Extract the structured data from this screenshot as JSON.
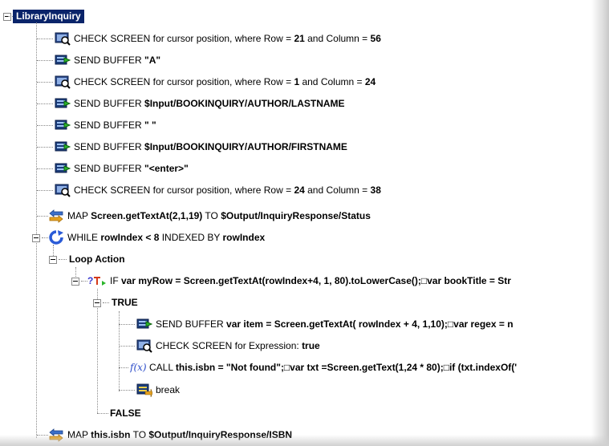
{
  "root": {
    "label": "LibraryInquiry"
  },
  "rows": [
    {
      "id": "r1",
      "icon": "screen-check-icon",
      "parts": [
        [
          "CHECK SCREEN for cursor position, where Row = ",
          false
        ],
        [
          "21",
          true
        ],
        [
          " and Column = ",
          false
        ],
        [
          "56",
          true
        ]
      ]
    },
    {
      "id": "r2",
      "icon": "send-buffer-icon",
      "parts": [
        [
          "SEND BUFFER ",
          false
        ],
        [
          "\"A\"",
          true
        ]
      ]
    },
    {
      "id": "r3",
      "icon": "screen-check-icon",
      "parts": [
        [
          "CHECK SCREEN for cursor position, where Row = ",
          false
        ],
        [
          "1",
          true
        ],
        [
          " and Column = ",
          false
        ],
        [
          "24",
          true
        ]
      ]
    },
    {
      "id": "r4",
      "icon": "send-buffer-icon",
      "parts": [
        [
          "SEND BUFFER ",
          false
        ],
        [
          "$Input/BOOKINQUIRY/AUTHOR/LASTNAME",
          true
        ]
      ]
    },
    {
      "id": "r5",
      "icon": "send-buffer-icon",
      "parts": [
        [
          "SEND BUFFER ",
          false
        ],
        [
          "\" \"",
          true
        ]
      ]
    },
    {
      "id": "r6",
      "icon": "send-buffer-icon",
      "parts": [
        [
          "SEND BUFFER ",
          false
        ],
        [
          "$Input/BOOKINQUIRY/AUTHOR/FIRSTNAME",
          true
        ]
      ]
    },
    {
      "id": "r7",
      "icon": "send-buffer-icon",
      "parts": [
        [
          "SEND BUFFER ",
          false
        ],
        [
          "\"<enter>\"",
          true
        ]
      ]
    },
    {
      "id": "r8",
      "icon": "screen-check-icon",
      "parts": [
        [
          "CHECK SCREEN for cursor position, where Row = ",
          false
        ],
        [
          "24",
          true
        ],
        [
          " and Column = ",
          false
        ],
        [
          "38",
          true
        ]
      ]
    },
    {
      "id": "r9",
      "icon": "map-icon",
      "parts": [
        [
          "MAP ",
          false
        ],
        [
          "Screen.getTextAt(2,1,19)",
          true
        ],
        [
          " TO ",
          false
        ],
        [
          "$Output/InquiryResponse/Status",
          true
        ]
      ]
    },
    {
      "id": "r10",
      "icon": "while-loop-icon",
      "parts": [
        [
          "WHILE ",
          false
        ],
        [
          "rowIndex < 8",
          true
        ],
        [
          " INDEXED BY ",
          false
        ],
        [
          "rowIndex",
          true
        ]
      ]
    },
    {
      "id": "r11",
      "icon": "",
      "parts": [
        [
          "Loop Action",
          true
        ]
      ]
    },
    {
      "id": "r12",
      "icon": "if-icon",
      "parts": [
        [
          "IF ",
          false
        ],
        [
          "var myRow = Screen.getTextAt(rowIndex+4, 1, 80).toLowerCase();□var bookTitle = Str",
          true
        ]
      ]
    },
    {
      "id": "r13",
      "icon": "",
      "parts": [
        [
          "TRUE",
          true
        ]
      ]
    },
    {
      "id": "r14",
      "icon": "send-buffer-icon",
      "parts": [
        [
          "SEND BUFFER ",
          false
        ],
        [
          "var item = Screen.getTextAt( rowIndex + 4, 1,10);□var regex = n",
          true
        ]
      ]
    },
    {
      "id": "r15",
      "icon": "screen-check-icon",
      "parts": [
        [
          "CHECK SCREEN for Expression: ",
          false
        ],
        [
          "true",
          true
        ]
      ]
    },
    {
      "id": "r16",
      "icon": "function-icon",
      "parts": [
        [
          "CALL ",
          false
        ],
        [
          "this.isbn = \"Not found\";□var txt =Screen.getText(1,24 * 80);□if (txt.indexOf('",
          true
        ]
      ]
    },
    {
      "id": "r17",
      "icon": "break-icon",
      "parts": [
        [
          "break",
          false
        ]
      ]
    },
    {
      "id": "r18",
      "icon": "",
      "parts": [
        [
          "FALSE",
          true
        ]
      ]
    },
    {
      "id": "r19",
      "icon": "map-icon",
      "parts": [
        [
          "MAP ",
          false
        ],
        [
          "this.isbn",
          true
        ],
        [
          " TO ",
          false
        ],
        [
          "$Output/InquiryResponse/ISBN",
          true
        ]
      ]
    }
  ],
  "colors": {
    "selection": "#0a246a",
    "tree_line": "#888888",
    "background": "#ffffff"
  }
}
